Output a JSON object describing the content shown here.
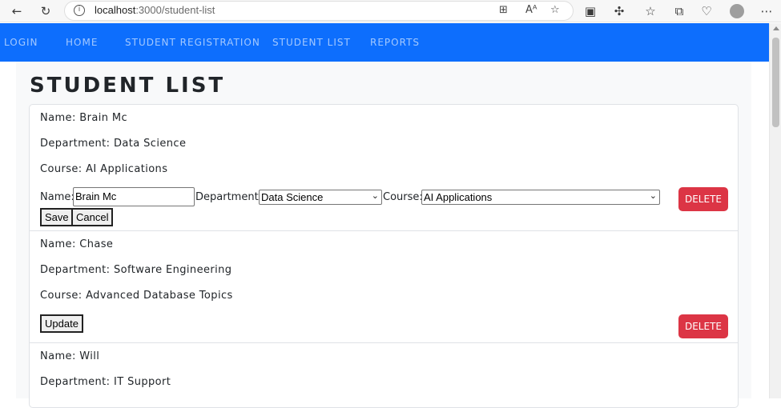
{
  "browser": {
    "url_host": "localhost",
    "url_path": ":3000/student-list",
    "read_aloud_label": "Aᴬ"
  },
  "nav": {
    "items": [
      "LOGIN",
      "HOME",
      "STUDENT REGISTRATION",
      "STUDENT LIST",
      "REPORTS"
    ]
  },
  "page": {
    "title": "STUDENT LIST"
  },
  "students": [
    {
      "name": "Name: Brain Mc",
      "department": "Department: Data Science",
      "course": "Course: AI Applications",
      "edit": {
        "name_label": "Name:",
        "name_value": "Brain Mc",
        "department_label": "Department:",
        "department_value": "Data Science",
        "course_label": "Course:",
        "course_value": "AI Applications",
        "save_label": "Save",
        "cancel_label": "Cancel"
      },
      "delete_label": "DELETE"
    },
    {
      "name": "Name: Chase",
      "department": "Department: Software Engineering",
      "course": "Course: Advanced Database Topics",
      "update_label": "Update",
      "delete_label": "DELETE"
    },
    {
      "name": "Name: Will",
      "department": "Department: IT Support"
    }
  ],
  "colors": {
    "navbar": "#0d6efd",
    "delete": "#dc3545",
    "container": "#f8f9fa"
  },
  "icons": [
    "back-icon",
    "refresh-icon",
    "info-icon",
    "apps-icon",
    "read-aloud-icon",
    "favorite-icon",
    "extension-icon",
    "puzzle-icon",
    "favorites-bar-icon",
    "collections-icon",
    "health-icon",
    "profile-icon",
    "more-icon"
  ]
}
